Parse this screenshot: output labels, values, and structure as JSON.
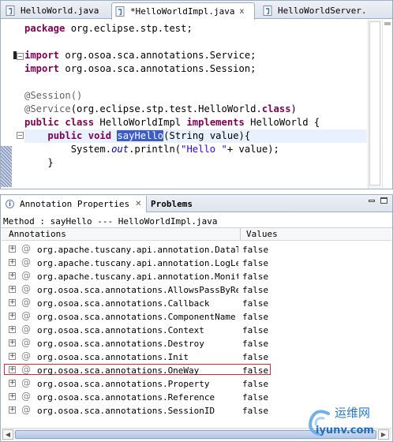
{
  "editor": {
    "tabs": [
      {
        "label": "HelloWorld.java",
        "dirty": false,
        "active": false
      },
      {
        "label": "*HelloWorldImpl.java",
        "dirty": true,
        "active": true
      },
      {
        "label": "HelloWorldServer.",
        "dirty": false,
        "active": false
      }
    ],
    "close_glyph": "x",
    "code": {
      "l1_kw": "package",
      "l1_rest": " org.eclipse.stp.test;",
      "l3_kw": "import",
      "l3_rest": " org.osoa.sca.annotations.Service;",
      "l4_kw": "import",
      "l4_rest": " org.osoa.sca.annotations.Session;",
      "l6": "@Session()",
      "l7_ann": "@Service",
      "l7_mid": "(org.eclipse.stp.test.HelloWorld.",
      "l7_kw": "class",
      "l7_end": ")",
      "l8_kw1": "public",
      "l8_kw2": "class",
      "l8_mid": " HelloWorldImpl ",
      "l8_kw3": "implements",
      "l8_end": " HelloWorld {",
      "l9_indent": "    ",
      "l9_kw1": "public",
      "l9_kw2": "void",
      "l9_sel": "sayHello",
      "l9_end": "(String value){",
      "l10_indent": "        System.",
      "l10_fld": "out",
      "l10_mid": ".println(",
      "l10_str": "\"Hello \"",
      "l10_end": "+ value);",
      "l11": "    }"
    }
  },
  "view": {
    "tabs": [
      {
        "label": "Annotation Properties",
        "active": true
      },
      {
        "label": "Problems",
        "active": false
      }
    ],
    "method_line": "Method : sayHello --- HelloWorldImpl.java",
    "columns": [
      "Annotations",
      "Values"
    ],
    "rows": [
      {
        "name": "org.apache.tuscany.api.annotation.DataType",
        "value": "false"
      },
      {
        "name": "org.apache.tuscany.api.annotation.LogLevel",
        "value": "false"
      },
      {
        "name": "org.apache.tuscany.api.annotation.Monitor",
        "value": "false"
      },
      {
        "name": "org.osoa.sca.annotations.AllowsPassByReference",
        "value": "false"
      },
      {
        "name": "org.osoa.sca.annotations.Callback",
        "value": "false"
      },
      {
        "name": "org.osoa.sca.annotations.ComponentName",
        "value": "false"
      },
      {
        "name": "org.osoa.sca.annotations.Context",
        "value": "false"
      },
      {
        "name": "org.osoa.sca.annotations.Destroy",
        "value": "false"
      },
      {
        "name": "org.osoa.sca.annotations.Init",
        "value": "false"
      },
      {
        "name": "org.osoa.sca.annotations.OneWay",
        "value": "false",
        "highlighted": true
      },
      {
        "name": "org.osoa.sca.annotations.Property",
        "value": "false"
      },
      {
        "name": "org.osoa.sca.annotations.Reference",
        "value": "false"
      },
      {
        "name": "org.osoa.sca.annotations.SessionID",
        "value": "false"
      }
    ],
    "expand_glyph": "+",
    "annotation_glyph": "@"
  },
  "watermark": {
    "cn": "运维网",
    "url": "iyunv.com"
  },
  "colors": {
    "keyword": "#7f0055",
    "annotation": "#646464",
    "string": "#2a00ff",
    "field": "#0000c0",
    "selection": "#3d5ccc",
    "highlight_box": "#cc2e2e",
    "watermark": "#1d6fc4"
  },
  "icons": {
    "java_file": "java-file-icon",
    "info": "info-icon",
    "close": "close-icon",
    "minimize": "minimize-icon",
    "maximize": "maximize-icon"
  }
}
